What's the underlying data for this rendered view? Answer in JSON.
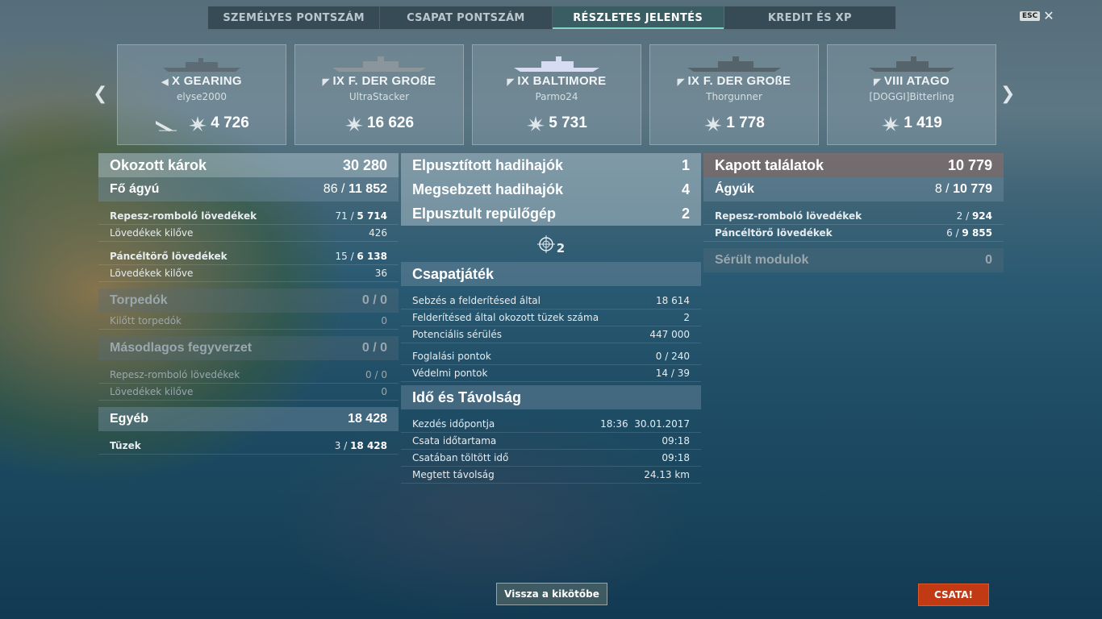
{
  "tabs": [
    "SZEMÉLYES PONTSZÁM",
    "CSAPAT PONTSZÁM",
    "RÉSZLETES JELENTÉS",
    "KREDIT ÉS XP"
  ],
  "active_tab_index": 2,
  "esc": {
    "key": "ESC",
    "close": "✕"
  },
  "nav": {
    "prev": "❮",
    "next": "❯"
  },
  "cards": [
    {
      "tier": "X",
      "ship": "GEARING",
      "player": "elyse2000",
      "score": "4 726",
      "class_icon": "destroyer-icon",
      "extra_icon": "sinking-ship-icon"
    },
    {
      "tier": "IX",
      "ship": "F. DER GROßE",
      "player": "UltraStacker",
      "score": "16 626",
      "class_icon": "battleship-icon"
    },
    {
      "tier": "IX",
      "ship": "BALTIMORE",
      "player": "Parmo24",
      "score": "5 731",
      "class_icon": "cruiser-icon"
    },
    {
      "tier": "IX",
      "ship": "F. DER GROßE",
      "player": "Thorgunner",
      "score": "1 778",
      "class_icon": "battleship-icon"
    },
    {
      "tier": "VIII",
      "ship": "ATAGO",
      "player": "[DOGGI]Bitterling",
      "score": "1 419",
      "class_icon": "cruiser-icon"
    }
  ],
  "left": {
    "damage": {
      "label": "Okozott károk",
      "value": "30 280"
    },
    "main_battery": {
      "label": "Fő ágyú",
      "hits": "86",
      "damage": "11 852"
    },
    "he": {
      "label": "Repesz-romboló lövedékek",
      "hits": "71",
      "damage": "5 714"
    },
    "he_fired": {
      "label": "Lövedékek kilőve",
      "value": "426"
    },
    "ap": {
      "label": "Páncéltörő lövedékek",
      "hits": "15",
      "damage": "6 138"
    },
    "ap_fired": {
      "label": "Lövedékek kilőve",
      "value": "36"
    },
    "torpedoes": {
      "label": "Torpedók",
      "value": "0 / 0"
    },
    "torps_fired": {
      "label": "Kilőtt torpedók",
      "value": "0"
    },
    "secondary": {
      "label": "Másodlagos fegyverzet",
      "value": "0 / 0"
    },
    "sec_he": {
      "label": "Repesz-romboló lövedékek",
      "value": "0 / 0"
    },
    "sec_fired": {
      "label": "Lövedékek kilőve",
      "value": "0"
    },
    "other": {
      "label": "Egyéb",
      "value": "18 428"
    },
    "fires": {
      "label": "Tüzek",
      "hits": "3",
      "damage": "18 428"
    }
  },
  "middle": {
    "destroyed": {
      "label": "Elpusztított hadihajók",
      "value": "1"
    },
    "damaged": {
      "label": "Megsebzett hadihajók",
      "value": "4"
    },
    "planes": {
      "label": "Elpusztult repülőgép",
      "value": "2"
    },
    "spotted": {
      "value": "2"
    },
    "team": {
      "label": "Csapatjáték"
    },
    "spot_damage": {
      "label": "Sebzés a felderítésed által",
      "value": "18 614"
    },
    "spot_fires": {
      "label": "Felderítésed által okozott tüzek száma",
      "value": "2"
    },
    "potential": {
      "label": "Potenciális sérülés",
      "value": "447 000"
    },
    "capture": {
      "label": "Foglalási pontok",
      "value": "0 / 240"
    },
    "defense": {
      "label": "Védelmi pontok",
      "value": "14 / 39"
    },
    "time": {
      "label": "Idő és Távolság"
    },
    "start": {
      "label": "Kezdés időpontja",
      "value": "18:36  30.01.2017"
    },
    "duration": {
      "label": "Csata időtartama",
      "value": "09:18"
    },
    "in_battle": {
      "label": "Csatában töltött idő",
      "value": "09:18"
    },
    "distance": {
      "label": "Megtett távolság",
      "value": "24.13 km"
    }
  },
  "right": {
    "received": {
      "label": "Kapott találatok",
      "value": "10 779"
    },
    "guns": {
      "label": "Ágyúk",
      "hits": "8",
      "damage": "10 779"
    },
    "he": {
      "label": "Repesz-romboló lövedékek",
      "hits": "2",
      "damage": "924"
    },
    "ap": {
      "label": "Páncéltörő lövedékek",
      "hits": "6",
      "damage": "9 855"
    },
    "modules": {
      "label": "Sérült modulok",
      "value": "0"
    }
  },
  "buttons": {
    "home": "Vissza a kikötőbe",
    "battle": "CSATA!"
  }
}
